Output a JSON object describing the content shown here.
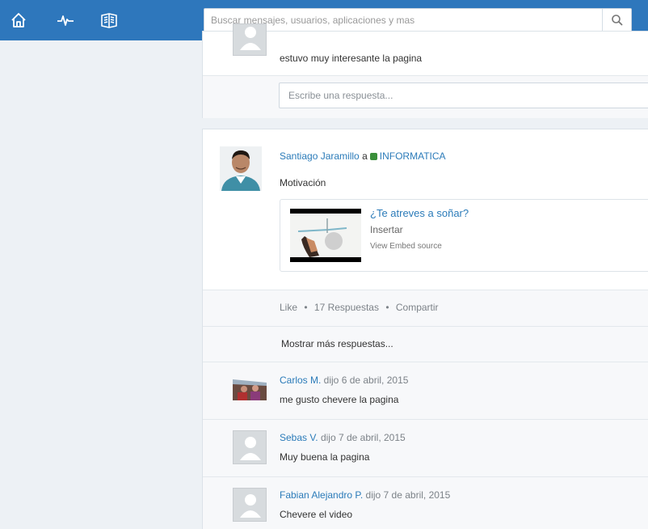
{
  "topbar": {
    "icons": [
      "home-icon",
      "activity-icon",
      "library-icon"
    ],
    "search_placeholder": "Buscar mensajes, usuarios, aplicaciones y mas"
  },
  "prev_post": {
    "reply_text": "estuvo muy interesante la pagina",
    "reply_input_placeholder": "Escribe una respuesta..."
  },
  "post": {
    "author": "Santiago Jaramillo",
    "to_word": "a",
    "group": "INFORMATICA",
    "body": "Motivación",
    "embed": {
      "title": "¿Te atreves a soñar?",
      "subtitle": "Insertar",
      "source_link": "View Embed source"
    },
    "actions": {
      "like": "Like",
      "sep1": "•",
      "replies": "17 Respuestas",
      "sep2": "•",
      "share": "Compartir"
    },
    "show_more": "Mostrar más respuestas..."
  },
  "replies": [
    {
      "author": "Carlos M.",
      "meta": " dijo 6 de abril, 2015",
      "text": "me gusto chevere la pagina"
    },
    {
      "author": "Sebas V.",
      "meta": " dijo 7 de abril, 2015",
      "text": "Muy buena la pagina"
    },
    {
      "author": "Fabian Alejandro P.",
      "meta": " dijo 7 de abril, 2015",
      "text": "Chevere el video"
    }
  ],
  "colors": {
    "topbar": "#2e77bc",
    "link": "#2b7bb9",
    "group_dot": "#3a8f3a"
  }
}
